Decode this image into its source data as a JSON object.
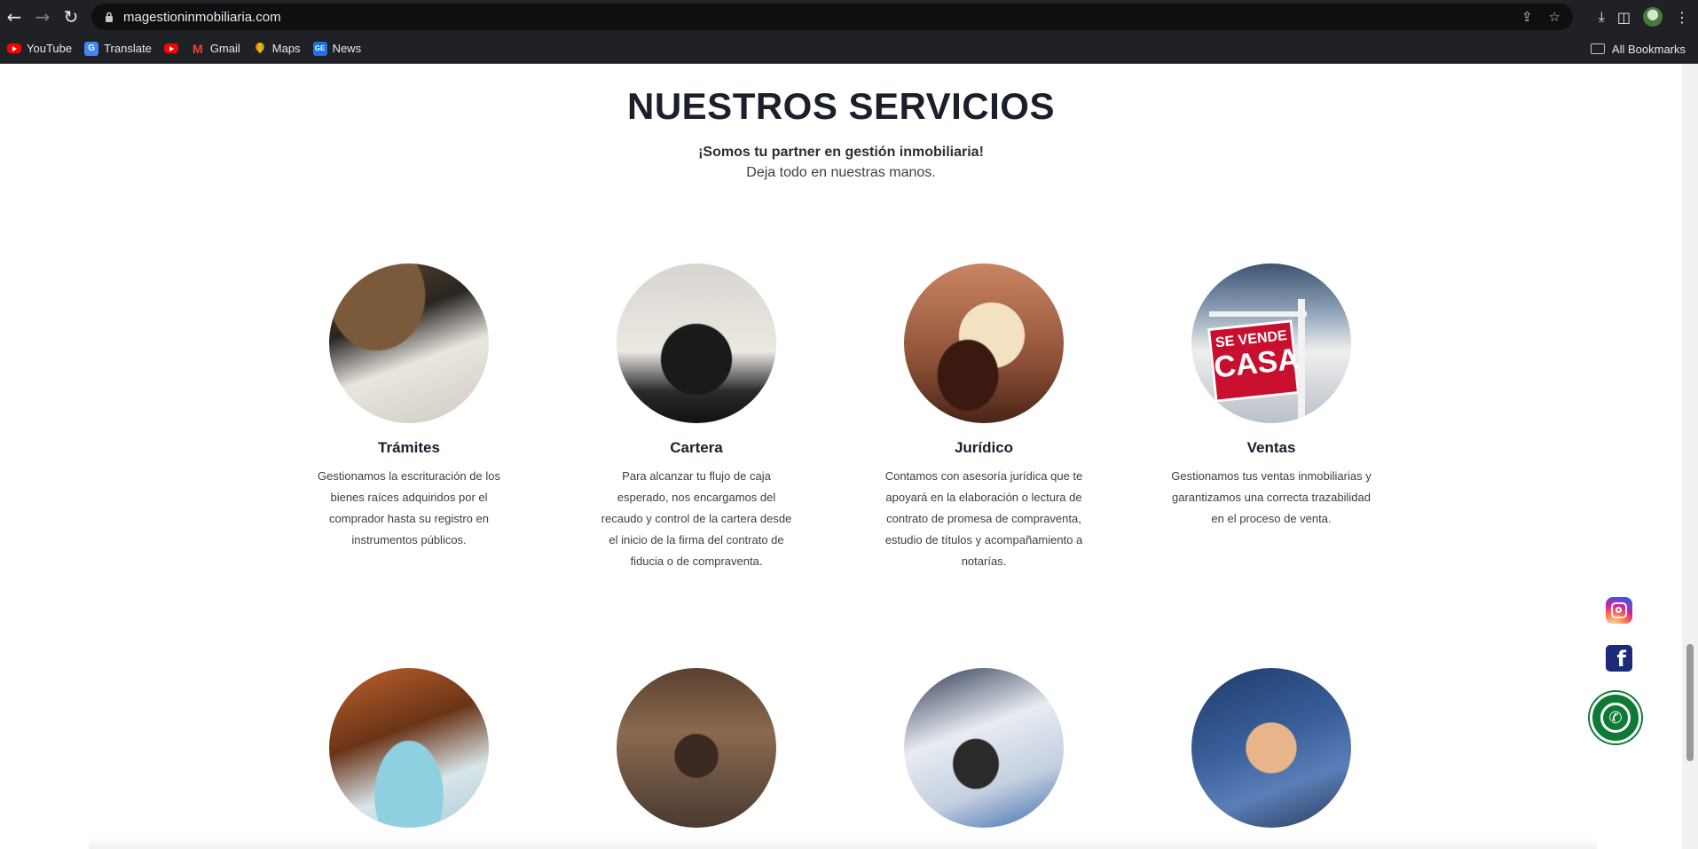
{
  "browser": {
    "url": "magestioninmobiliaria.com",
    "bookmarks": [
      {
        "label": "YouTube",
        "icon": "youtube-icon"
      },
      {
        "label": "Translate",
        "icon": "translate-icon"
      },
      {
        "label": "",
        "icon": "youtube-icon"
      },
      {
        "label": "Gmail",
        "icon": "gmail-icon"
      },
      {
        "label": "Maps",
        "icon": "maps-icon"
      },
      {
        "label": "News",
        "icon": "news-icon"
      }
    ],
    "all_bookmarks": "All Bookmarks"
  },
  "section": {
    "title": "NUESTROS SERVICIOS",
    "tagline": "¡Somos tu partner en gestión inmobiliaria!",
    "subtitle": "Deja todo en nuestras manos."
  },
  "services": [
    {
      "title": "Trámites",
      "desc": "Gestionamos la escrituración de los bienes raíces adquiridos por el comprador hasta su registro en instrumentos públicos."
    },
    {
      "title": "Cartera",
      "desc": "Para alcanzar tu flujo de caja esperado, nos encargamos del recaudo y control de la cartera desde el inicio de la firma del contrato de fiducia o de compraventa."
    },
    {
      "title": "Jurídico",
      "desc": "Contamos con asesoría jurídica que te apoyará en la elaboración o lectura de contrato de promesa de compraventa, estudio de títulos y acompañamiento a notarías."
    },
    {
      "title": "Ventas",
      "desc": "Gestionamos tus ventas inmobiliarias y garantizamos una correcta trazabilidad en el proceso de venta."
    }
  ],
  "sign": {
    "line1": "SE VENDE",
    "line2": "CASA"
  },
  "colors": {
    "chrome": "#202124",
    "heading": "#1a1f2b",
    "whatsapp": "#0e7a35",
    "facebook": "#1c2a7a"
  }
}
